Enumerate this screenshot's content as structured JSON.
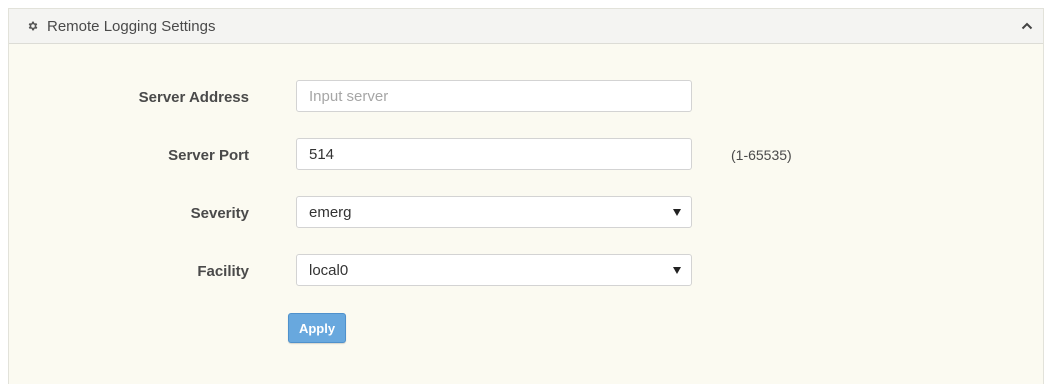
{
  "panel": {
    "title": "Remote Logging Settings",
    "icon": "gear-icon",
    "collapse_icon": "chevron-up-icon"
  },
  "form": {
    "server_address": {
      "label": "Server Address",
      "value": "",
      "placeholder": "Input server"
    },
    "server_port": {
      "label": "Server Port",
      "value": "514",
      "hint": "(1-65535)"
    },
    "severity": {
      "label": "Severity",
      "selected": "emerg"
    },
    "facility": {
      "label": "Facility",
      "selected": "local0"
    },
    "apply_label": "Apply"
  },
  "colors": {
    "panel_background": "#fbfaf1",
    "header_background": "#f4f4f2",
    "apply_button": "#68a8de"
  }
}
